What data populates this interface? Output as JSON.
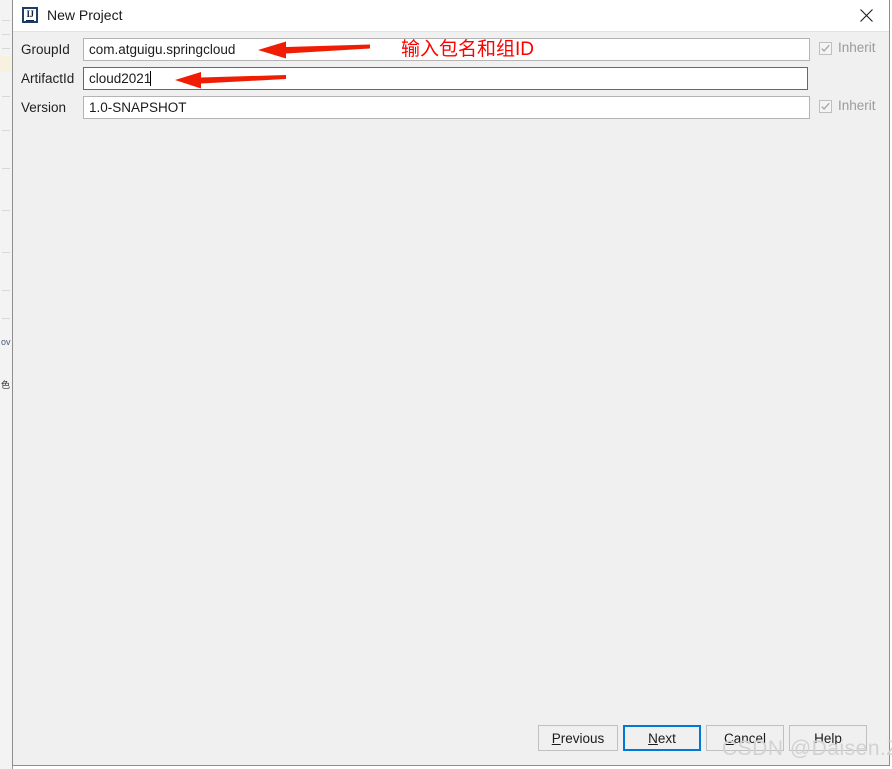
{
  "window": {
    "title": "New Project",
    "icon": "intellij-idea-icon",
    "close_icon": "close-icon"
  },
  "form": {
    "fields": [
      {
        "label": "GroupId",
        "value": "com.atguigu.springcloud",
        "focused": false,
        "caret": false,
        "inherit_label": "Inherit",
        "inherit_checked": true
      },
      {
        "label": "ArtifactId",
        "value": "cloud2021",
        "focused": true,
        "caret": true,
        "inherit_label": "",
        "inherit_checked": false
      },
      {
        "label": "Version",
        "value": "1.0-SNAPSHOT",
        "focused": false,
        "caret": false,
        "inherit_label": "Inherit",
        "inherit_checked": true
      }
    ]
  },
  "annotation": {
    "text": "输入包名和组ID",
    "color": "#fe0000",
    "arrows": [
      {
        "name": "annotation-arrow-groupid",
        "points_to": "GroupId"
      },
      {
        "name": "annotation-arrow-artifactid",
        "points_to": "ArtifactId"
      }
    ]
  },
  "footer": {
    "buttons": [
      {
        "name": "previous-button",
        "label": "Previous",
        "mnemonic": "P",
        "default": false
      },
      {
        "name": "next-button",
        "label": "Next",
        "mnemonic": "N",
        "default": true
      },
      {
        "name": "cancel-button",
        "label": "Cancel",
        "mnemonic": "C",
        "default": false
      },
      {
        "name": "help-button",
        "label": "Help",
        "mnemonic": "",
        "default": false
      }
    ]
  },
  "watermark": {
    "text": "CSDN @Daisen.Z"
  },
  "colors": {
    "accent": "#0078d7",
    "annotation": "#fe0000",
    "dialog_bg": "#f0f0f0",
    "titlebar_bg": "#ffffff",
    "field_border_focused": "#1e7cc4"
  }
}
